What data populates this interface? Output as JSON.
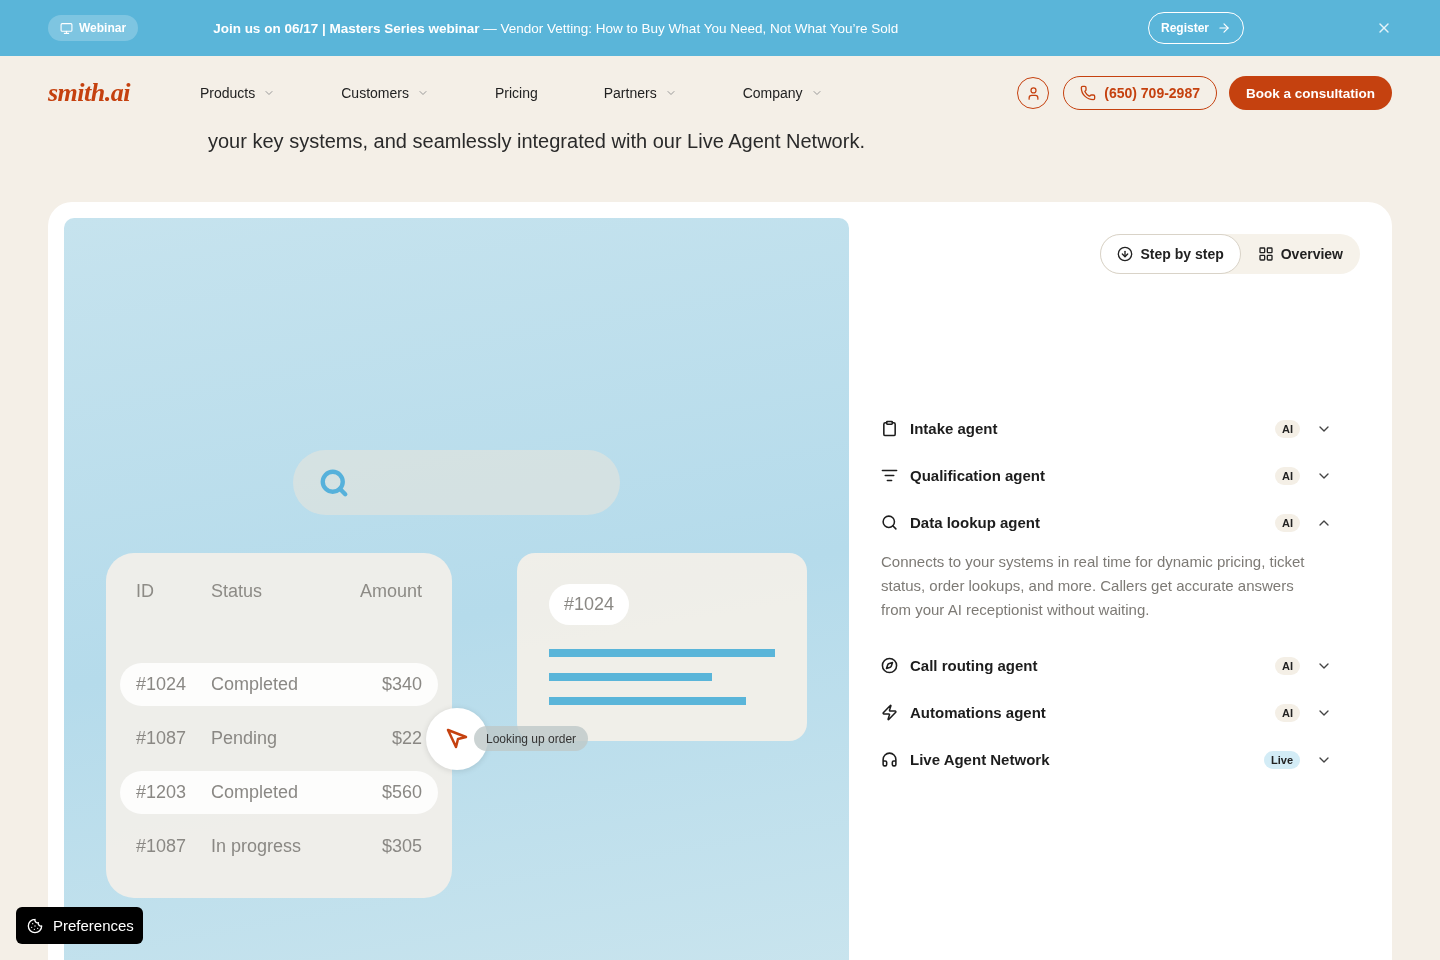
{
  "banner": {
    "tag": "Webinar",
    "headline": "**Join us on 06/17 | Masters Series webinar** — Vendor Vetting: How to Buy What You Need, Not What You’re Sold",
    "register": "Register"
  },
  "nav": {
    "logo": "smith.ai",
    "items": [
      {
        "label": "Products",
        "dropdown": true
      },
      {
        "label": "Customers",
        "dropdown": true
      },
      {
        "label": "Pricing",
        "dropdown": false
      },
      {
        "label": "Partners",
        "dropdown": true
      },
      {
        "label": "Company",
        "dropdown": true
      }
    ],
    "phone": "(650) 709-2987",
    "cta": "Book a consultation"
  },
  "intro": "your key systems, and seamlessly integrated with our Live Agent Network.",
  "illustration": {
    "columns": [
      "ID",
      "Status",
      "Amount"
    ],
    "rows": [
      {
        "cells": [
          "#1024",
          "Completed",
          "$340"
        ],
        "highlighted": true
      },
      {
        "cells": [
          "#1087",
          "Pending",
          "$22"
        ],
        "highlighted": false
      },
      {
        "cells": [
          "#1203",
          "Completed",
          "$560"
        ],
        "highlighted": true
      },
      {
        "cells": [
          "#1087",
          "In progress",
          "$305"
        ],
        "highlighted": false
      }
    ],
    "detail_chip": "#1024",
    "tooltip": "Looking up order"
  },
  "view_toggle": [
    {
      "label": "Step by step",
      "selected": true
    },
    {
      "label": "Overview",
      "selected": false
    }
  ],
  "agents": [
    {
      "title": "Intake agent",
      "badge": "AI",
      "kind": "ai",
      "expanded": false
    },
    {
      "title": "Qualification agent",
      "badge": "AI",
      "kind": "ai",
      "expanded": false
    },
    {
      "title": "Data lookup agent",
      "badge": "AI",
      "kind": "ai",
      "expanded": true,
      "description": "Connects to your systems in real time for dynamic pricing, ticket status, order lookups, and more. Callers get accurate answers from your AI receptionist without waiting."
    },
    {
      "title": "Call routing agent",
      "badge": "AI",
      "kind": "ai",
      "expanded": false
    },
    {
      "title": "Automations agent",
      "badge": "AI",
      "kind": "ai",
      "expanded": false
    },
    {
      "title": "Live Agent Network",
      "badge": "Live",
      "kind": "live",
      "expanded": false
    }
  ],
  "preferences": "Preferences"
}
